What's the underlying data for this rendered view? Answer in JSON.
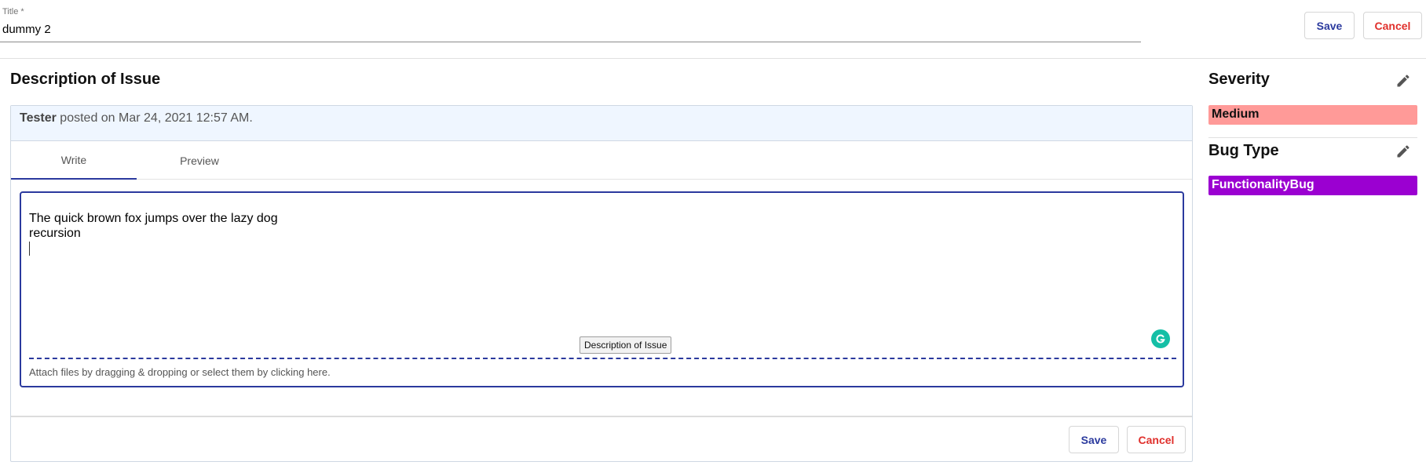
{
  "title_field": {
    "label": "Title *",
    "value": "dummy 2"
  },
  "header_actions": {
    "save_label": "Save",
    "cancel_label": "Cancel"
  },
  "description": {
    "heading": "Description of Issue",
    "author": "Tester",
    "posted_text": "posted on Mar 24, 2021 12:57 AM.",
    "tabs": [
      {
        "label": "Write",
        "active": true
      },
      {
        "label": "Preview",
        "active": false
      }
    ],
    "editor_lines": [
      "The quick brown fox jumps over the lazy dog",
      "recursion"
    ],
    "tooltip": "Description of Issue",
    "attach_hint": "Attach files by dragging & dropping or select them by clicking here.",
    "save_label": "Save",
    "cancel_label": "Cancel"
  },
  "sidebar": {
    "severity": {
      "heading": "Severity",
      "value": "Medium",
      "color": "#ff9a98"
    },
    "bug_type": {
      "heading": "Bug Type",
      "value": "FunctionalityBug",
      "color": "#9b00d1"
    }
  },
  "colors": {
    "accent": "#2b3a9e",
    "cancel": "#e0302c",
    "grammarly": "#15bfa6"
  },
  "icons": {
    "edit": "pencil-icon",
    "grammarly": "grammarly-icon"
  }
}
